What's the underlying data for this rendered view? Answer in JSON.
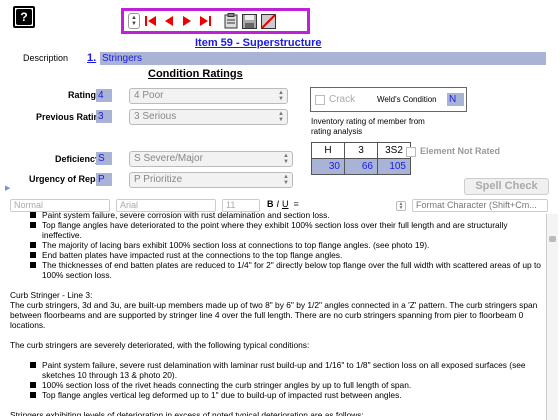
{
  "toolbar": {
    "icons": [
      "stepper",
      "first-record",
      "previous-record",
      "next-record",
      "last-record",
      "clipboard",
      "save",
      "delete"
    ]
  },
  "item_title": "Item 59 - Superstructure",
  "description": {
    "label": "Description",
    "number": "1.",
    "value": "Stringers"
  },
  "section_title": "Condition Ratings",
  "rating": {
    "label": "Rating",
    "code": "4",
    "select": "4  Poor"
  },
  "previous_rating": {
    "label": "Previous Rating",
    "code": "3",
    "select": "3  Serious"
  },
  "crack": {
    "label": "Crack",
    "weld_label": "Weld's Condition",
    "weld_value": "N"
  },
  "inventory_note": "Inventory rating of member from rating analysis",
  "deficiency": {
    "label": "Deficiency",
    "code": "S",
    "select": "S   Severe/Major"
  },
  "urgency": {
    "label": "Urgency of Repair",
    "code": "P",
    "select": "P  Prioritize"
  },
  "rating_table": {
    "headers": [
      "H",
      "3",
      "3S2"
    ],
    "values": [
      "30",
      "66",
      "105"
    ]
  },
  "element_not_rated": "Element Not Rated",
  "spell_check": "Spell Check",
  "format_bar": {
    "style": "Normal",
    "font": "Arial",
    "size": "11",
    "bold": "B",
    "italic": "I",
    "underline": "U",
    "format_char": "Format Character (Shift+Cm..."
  },
  "editor": {
    "lines": [
      {
        "b": true,
        "t": "Paint system failure, severe corrosion with rust delamination and section loss."
      },
      {
        "b": true,
        "t": "Top flange angles have deteriorated to the point where they exhibit 100% section loss over their full length and are structurally ineffective."
      },
      {
        "b": true,
        "t": "The majority of lacing bars exhibit 100% section loss at connections to top flange angles. (see photo 19)."
      },
      {
        "b": true,
        "t": "End batten plates have impacted rust at the connections to the top flange angles."
      },
      {
        "b": true,
        "t": "The thicknesses of end batten plates are reduced to 1/4\" for 2\" directly below top flange over the full width with scattered areas of up to 100% section loss."
      },
      {
        "b": false,
        "t": ""
      },
      {
        "b": false,
        "t": "Curb Stringer - Line 3:"
      },
      {
        "b": false,
        "t": "The curb stringers, 3d and 3u, are built-up members made up of two 8\" by 6\" by 1/2\" angles connected in a 'Z' pattern.  The curb stringers span between floorbeams and are supported by stringer line 4 over the full length.  There are no curb stringers spanning from pier to floorbeam 0 locations."
      },
      {
        "b": false,
        "t": ""
      },
      {
        "b": false,
        "t": "The curb stringers are severely deteriorated, with the following typical conditions:"
      },
      {
        "b": false,
        "t": ""
      },
      {
        "b": true,
        "t": "Paint system failure, severe rust delamination with laminar rust build-up and 1/16\" to 1/8\" section loss on all exposed surfaces (see sketches 10 through 13 & photo 20)."
      },
      {
        "b": true,
        "t": "100% section loss of the rivet heads connecting the curb stringer angles by up to full length of span."
      },
      {
        "b": true,
        "t": "Top flange angles vertical leg deformed up to 1\" due to build-up of impacted rust between angles."
      },
      {
        "b": false,
        "t": ""
      },
      {
        "b": false,
        "t": "Stringers exhibiting levels of deterioration in excess of noted typical deterioration are as follows:"
      }
    ]
  }
}
